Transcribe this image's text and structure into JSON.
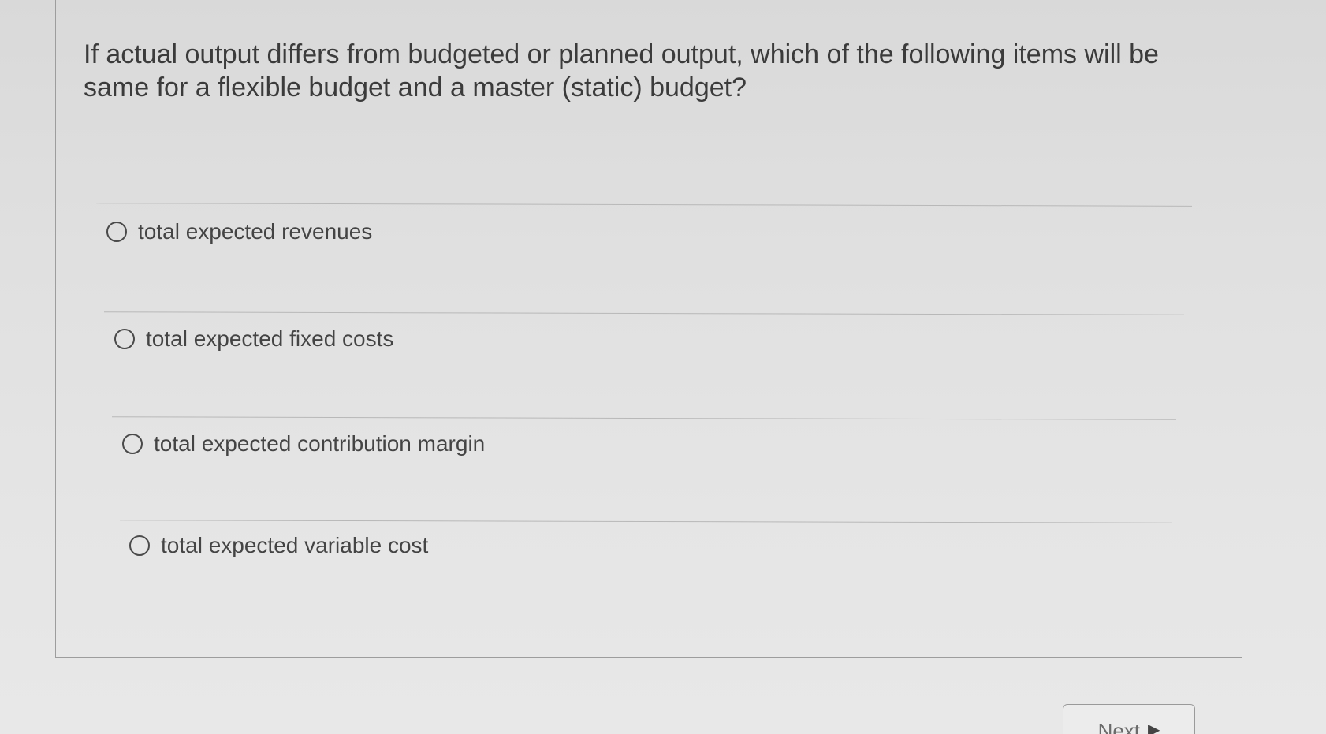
{
  "question": {
    "text": "If actual output differs from budgeted or planned output, which of the following items will be same for a flexible budget and a master (static) budget?"
  },
  "options": [
    {
      "label": "total expected revenues",
      "selected": false
    },
    {
      "label": "total expected fixed costs",
      "selected": false
    },
    {
      "label": "total expected contribution margin",
      "selected": false
    },
    {
      "label": "total expected variable cost",
      "selected": false
    }
  ],
  "navigation": {
    "next_label": "Next",
    "next_icon": "triangle-right-icon"
  }
}
